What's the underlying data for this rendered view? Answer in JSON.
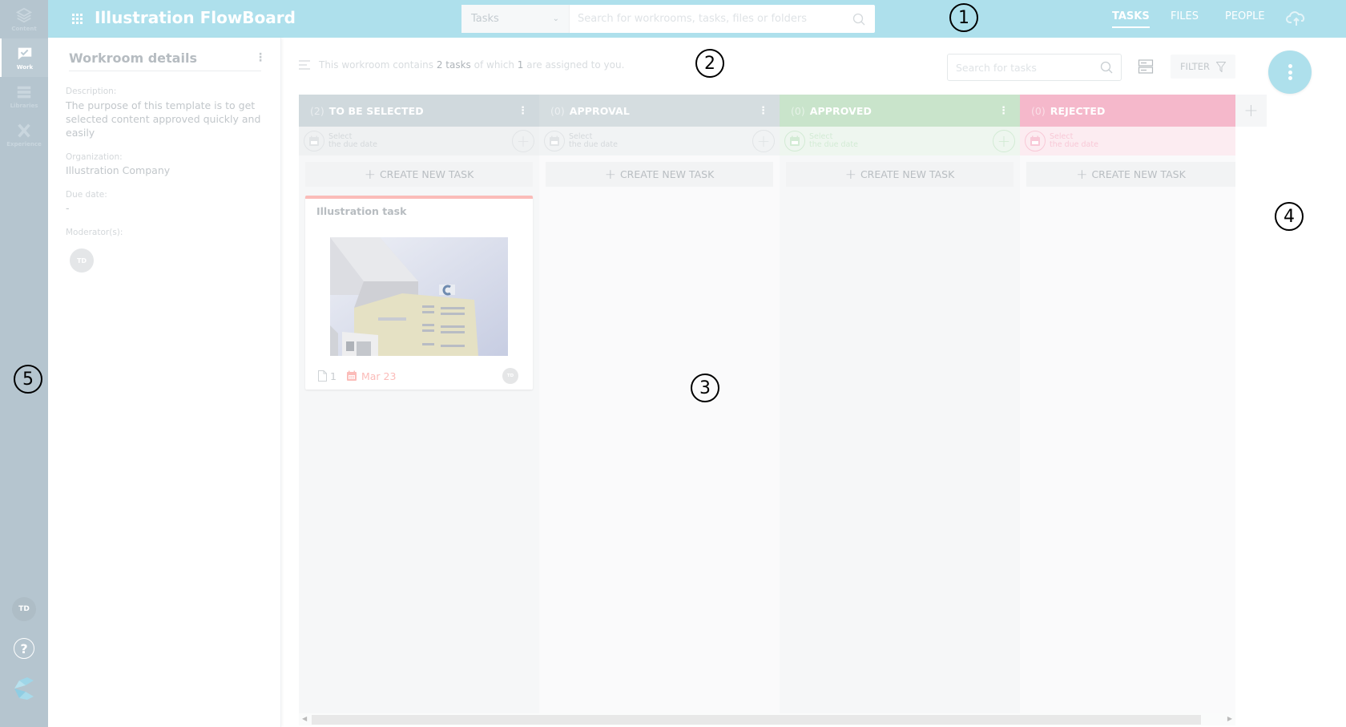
{
  "rail": {
    "items": [
      {
        "label": "Content",
        "icon": "layers-icon",
        "active": false
      },
      {
        "label": "Work",
        "icon": "check-bubble-icon",
        "active": true
      },
      {
        "label": "Libraries",
        "icon": "list-icon",
        "active": false
      },
      {
        "label": "Experience",
        "icon": "x-icon",
        "active": false
      }
    ],
    "avatar_initials": "TD",
    "help_label": "?"
  },
  "topbar": {
    "title": "Illustration FlowBoard",
    "search": {
      "scope": "Tasks",
      "placeholder": "Search for workrooms, tasks, files or folders"
    },
    "tabs": [
      {
        "label": "TASKS",
        "active": true
      },
      {
        "label": "FILES",
        "active": false
      },
      {
        "label": "PEOPLE",
        "active": false
      }
    ]
  },
  "details": {
    "title": "Workroom details",
    "description_label": "Description:",
    "description": "The purpose of this template is to get selected content approved quickly and easily",
    "organization_label": "Organization:",
    "organization": "Illustration Company",
    "due_date_label": "Due date:",
    "due_date": "-",
    "moderators_label": "Moderator(s):",
    "moderator_initials": "TD"
  },
  "toolbar": {
    "summary_pre": "This workroom contains ",
    "task_count": "2 tasks",
    "summary_mid": " of which ",
    "assigned_count": "1",
    "summary_post": " are assigned to you.",
    "task_search_placeholder": "Search for tasks",
    "filter_label": "FILTER"
  },
  "board": {
    "due_date_line1": "Select",
    "due_date_line2": "the due date",
    "create_label": "CREATE NEW TASK",
    "columns": [
      {
        "count": "(2)",
        "name": "TO BE SELECTED",
        "header_color": "#d0d9dd",
        "row_color": "#eff1f2",
        "accent": "#e1e4e6",
        "text_color": "#d4d8db",
        "body_color": "#f6f7f8",
        "menu": true
      },
      {
        "count": "(0)",
        "name": "APPROVAL",
        "header_color": "#d5dde0",
        "row_color": "#f1f3f4",
        "accent": "#e1e4e6",
        "text_color": "#d4d8db",
        "body_color": "#fafafb",
        "menu": true
      },
      {
        "count": "(0)",
        "name": "APPROVED",
        "header_color": "#c9e4cb",
        "row_color": "#eef6ef",
        "accent": "#d3ebd5",
        "text_color": "#d3ebd5",
        "body_color": "#f6f7f8",
        "menu": true
      },
      {
        "count": "(0)",
        "name": "REJECTED",
        "header_color": "#f5b8cb",
        "row_color": "#fcecf1",
        "accent": "#f8c9d7",
        "text_color": "#f8c9d7",
        "body_color": "#fafafb",
        "menu": false
      }
    ],
    "task": {
      "title": "Illustration task",
      "file_count": "1",
      "due": "Mar 23",
      "assignee_initials": "TD"
    }
  },
  "annotations": [
    "1",
    "2",
    "3",
    "4",
    "5"
  ]
}
